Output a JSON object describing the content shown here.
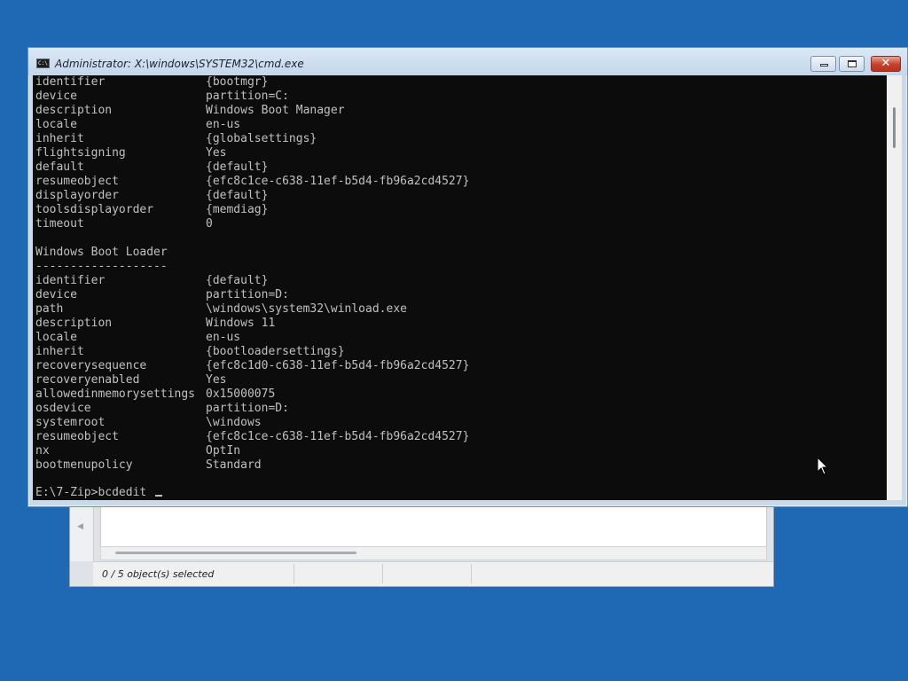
{
  "background_window": {
    "status_text": "0 / 5 object(s) selected"
  },
  "cmd_window": {
    "title": "Administrator: X:\\windows\\SYSTEM32\\cmd.exe",
    "controls": {
      "minimize": "minimize-icon",
      "maximize": "maximize-icon",
      "close": "✕"
    },
    "boot_manager": [
      {
        "key": "identifier",
        "value": "{bootmgr}"
      },
      {
        "key": "device",
        "value": "partition=C:"
      },
      {
        "key": "description",
        "value": "Windows Boot Manager"
      },
      {
        "key": "locale",
        "value": "en-us"
      },
      {
        "key": "inherit",
        "value": "{globalsettings}"
      },
      {
        "key": "flightsigning",
        "value": "Yes"
      },
      {
        "key": "default",
        "value": "{default}"
      },
      {
        "key": "resumeobject",
        "value": "{efc8c1ce-c638-11ef-b5d4-fb96a2cd4527}"
      },
      {
        "key": "displayorder",
        "value": "{default}"
      },
      {
        "key": "toolsdisplayorder",
        "value": "{memdiag}"
      },
      {
        "key": "timeout",
        "value": "0"
      }
    ],
    "loader_heading": "Windows Boot Loader",
    "loader_rule": "-------------------",
    "boot_loader": [
      {
        "key": "identifier",
        "value": "{default}"
      },
      {
        "key": "device",
        "value": "partition=D:"
      },
      {
        "key": "path",
        "value": "\\windows\\system32\\winload.exe"
      },
      {
        "key": "description",
        "value": "Windows 11"
      },
      {
        "key": "locale",
        "value": "en-us"
      },
      {
        "key": "inherit",
        "value": "{bootloadersettings}"
      },
      {
        "key": "recoverysequence",
        "value": "{efc8c1d0-c638-11ef-b5d4-fb96a2cd4527}"
      },
      {
        "key": "recoveryenabled",
        "value": "Yes"
      },
      {
        "key": "allowedinmemorysettings",
        "value": "0x15000075"
      },
      {
        "key": "osdevice",
        "value": "partition=D:"
      },
      {
        "key": "systemroot",
        "value": "\\windows"
      },
      {
        "key": "resumeobject",
        "value": "{efc8c1ce-c638-11ef-b5d4-fb96a2cd4527}"
      },
      {
        "key": "nx",
        "value": "OptIn"
      },
      {
        "key": "bootmenupolicy",
        "value": "Standard"
      }
    ],
    "prompt": "E:\\7-Zip>bcdedit "
  },
  "colors": {
    "desktop": "#1f68b4",
    "console_bg": "#0c0c0c",
    "console_text": "#c0c0c0",
    "close_button": "#c4402c"
  }
}
